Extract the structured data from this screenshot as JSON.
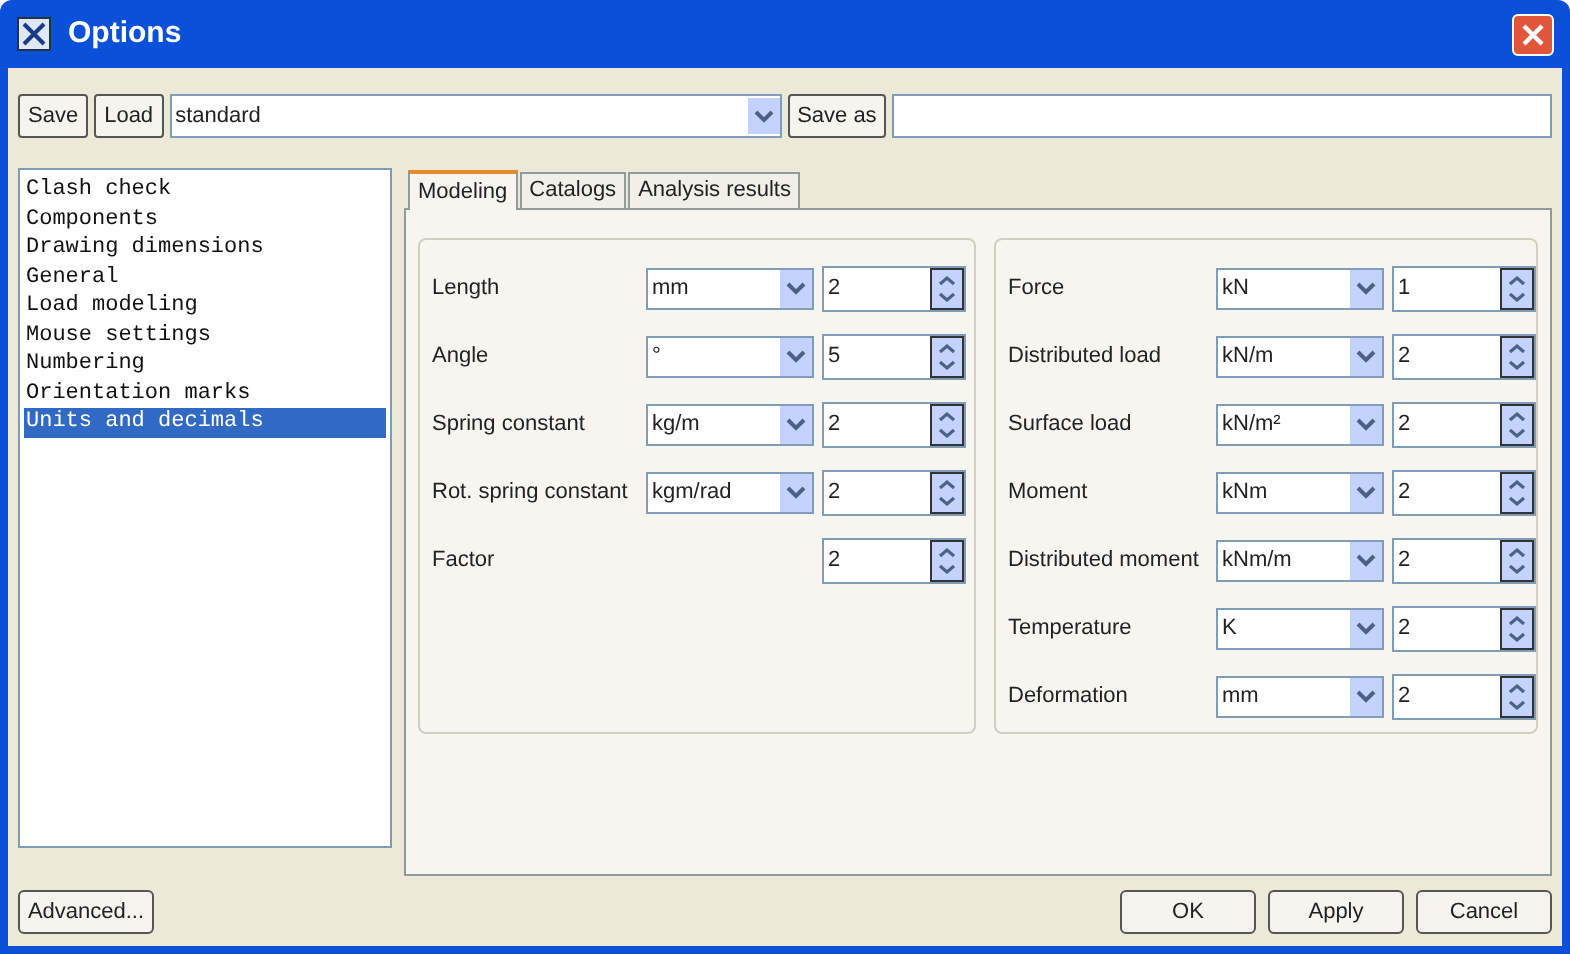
{
  "window": {
    "title": "Options"
  },
  "toolbar": {
    "save": "Save",
    "load": "Load",
    "profile": "standard",
    "save_as": "Save as"
  },
  "sidebar": {
    "items": [
      {
        "label": "Clash check",
        "selected": false
      },
      {
        "label": "Components",
        "selected": false
      },
      {
        "label": "Drawing dimensions",
        "selected": false
      },
      {
        "label": "General",
        "selected": false
      },
      {
        "label": "Load modeling",
        "selected": false
      },
      {
        "label": "Mouse settings",
        "selected": false
      },
      {
        "label": "Numbering",
        "selected": false
      },
      {
        "label": "Orientation marks",
        "selected": false
      },
      {
        "label": "Units and decimals",
        "selected": true
      }
    ]
  },
  "tabs": [
    {
      "label": "Modeling",
      "selected": true
    },
    {
      "label": "Catalogs",
      "selected": false
    },
    {
      "label": "Analysis results",
      "selected": false
    }
  ],
  "groups": [
    {
      "rows": [
        {
          "label": "Length",
          "unit": "mm",
          "decimals": "2"
        },
        {
          "label": "Angle",
          "unit": "°",
          "decimals": "5"
        },
        {
          "label": "Spring constant",
          "unit": "kg/m",
          "decimals": "2"
        },
        {
          "label": "Rot. spring constant",
          "unit": "kgm/rad",
          "decimals": "2"
        },
        {
          "label": "Factor",
          "decimals": "2"
        }
      ]
    },
    {
      "rows": [
        {
          "label": "Force",
          "unit": "kN",
          "decimals": "1"
        },
        {
          "label": "Distributed load",
          "unit": "kN/m",
          "decimals": "2"
        },
        {
          "label": "Surface load",
          "unit": "kN/m²",
          "decimals": "2"
        },
        {
          "label": "Moment",
          "unit": "kNm",
          "decimals": "2"
        },
        {
          "label": "Distributed moment",
          "unit": "kNm/m",
          "decimals": "2"
        },
        {
          "label": "Temperature",
          "unit": "K",
          "decimals": "2"
        },
        {
          "label": "Deformation",
          "unit": "mm",
          "decimals": "2"
        }
      ]
    }
  ],
  "buttons": {
    "advanced": "Advanced...",
    "ok": "OK",
    "apply": "Apply",
    "cancel": "Cancel"
  }
}
